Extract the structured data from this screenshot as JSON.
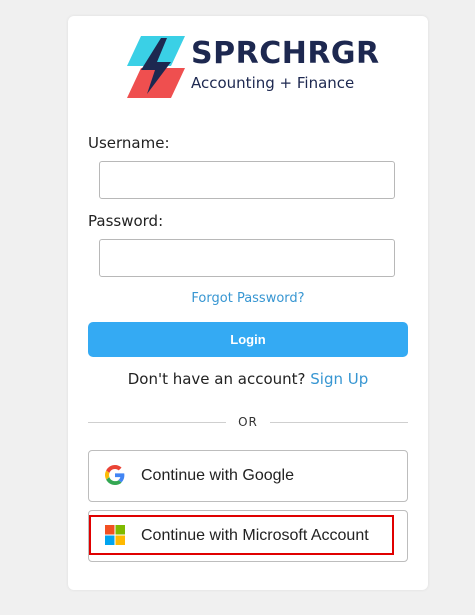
{
  "brand": {
    "name": "SPRCHRGR",
    "tagline": "Accounting + Finance",
    "colors": {
      "teal": "#3ad0e6",
      "red": "#ef4f4f",
      "navy": "#1d2850"
    }
  },
  "form": {
    "username_label": "Username:",
    "username_value": "",
    "password_label": "Password:",
    "password_value": "",
    "forgot_label": "Forgot Password?",
    "login_label": "Login",
    "signup_prompt": "Don't have an account?",
    "signup_label": "Sign Up",
    "divider_label": "OR"
  },
  "social": {
    "google_label": "Continue with Google",
    "google_icon": "google-icon",
    "microsoft_label": "Continue with Microsoft Account",
    "microsoft_icon": "microsoft-icon"
  },
  "accent_color": "#34aaf3",
  "highlight_color": "#e00000"
}
